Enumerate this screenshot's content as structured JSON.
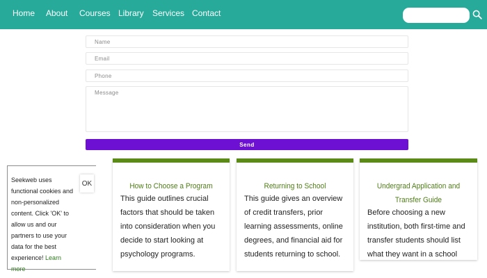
{
  "nav": {
    "items": [
      {
        "label": "Home"
      },
      {
        "label": "About"
      },
      {
        "label": "Courses"
      },
      {
        "label": "Library"
      },
      {
        "label": "Services"
      },
      {
        "label": "Contact"
      }
    ],
    "search": {
      "value": "",
      "icon": "search-icon"
    }
  },
  "form": {
    "name_placeholder": "Name",
    "email_placeholder": "Email",
    "phone_placeholder": "Phone",
    "message_placeholder": "Message",
    "send_label": "Send"
  },
  "cookie": {
    "text": "Seekweb uses functional cookies and non-personalized content. Click 'OK' to allow us and our partners to use your data for the best experience!",
    "learn_more": "Learn more",
    "ok_label": "OK"
  },
  "cards": [
    {
      "title": "How to Choose a Program",
      "body": "This guide outlines crucial factors that should be taken into consideration when you decide to start looking at psychology programs."
    },
    {
      "title": "Returning to School",
      "body": "This guide gives an overview of credit transfers, prior learning assessments, online degrees, and financial aid for students returning to school."
    },
    {
      "title": "Undergrad Application and Transfer Guide",
      "body": "Before choosing a new institution, both first-time and transfer students should list what they want in a school"
    }
  ],
  "colors": {
    "nav_bg": "#27aa9a",
    "send_button": "#6d10d3",
    "card_accent": "#5c8a18",
    "card_title": "#4e7e14"
  }
}
